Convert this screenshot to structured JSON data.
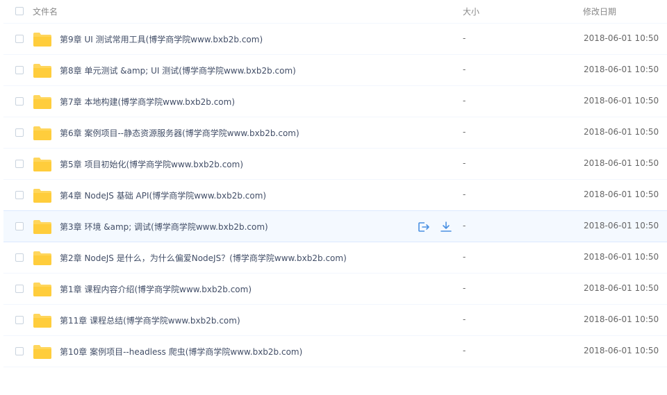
{
  "header": {
    "name_label": "文件名",
    "size_label": "大小",
    "date_label": "修改日期"
  },
  "files": [
    {
      "name": "第9章 UI 测试常用工具(博学商学院www.bxb2b.com)",
      "size": "-",
      "date": "2018-06-01 10:50"
    },
    {
      "name": "第8章 单元测试 &amp; UI 测试(博学商学院www.bxb2b.com)",
      "size": "-",
      "date": "2018-06-01 10:50"
    },
    {
      "name": "第7章 本地构建(博学商学院www.bxb2b.com)",
      "size": "-",
      "date": "2018-06-01 10:50"
    },
    {
      "name": "第6章 案例项目--静态资源服务器(博学商学院www.bxb2b.com)",
      "size": "-",
      "date": "2018-06-01 10:50"
    },
    {
      "name": "第5章 项目初始化(博学商学院www.bxb2b.com)",
      "size": "-",
      "date": "2018-06-01 10:50"
    },
    {
      "name": "第4章 NodeJS 基础 API(博学商学院www.bxb2b.com)",
      "size": "-",
      "date": "2018-06-01 10:50"
    },
    {
      "name": "第3章 环境 &amp; 调试(博学商学院www.bxb2b.com)",
      "size": "-",
      "date": "2018-06-01 10:50"
    },
    {
      "name": "第2章 NodeJS 是什么，为什么偏爱NodeJS？(博学商学院www.bxb2b.com)",
      "size": "-",
      "date": "2018-06-01 10:50"
    },
    {
      "name": "第1章 课程内容介绍(博学商学院www.bxb2b.com)",
      "size": "-",
      "date": "2018-06-01 10:50"
    },
    {
      "name": "第11章 课程总结(博学商学院www.bxb2b.com)",
      "size": "-",
      "date": "2018-06-01 10:50"
    },
    {
      "name": "第10章 案例项目--headless 爬虫(博学商学院www.bxb2b.com)",
      "size": "-",
      "date": "2018-06-01 10:50"
    }
  ],
  "icons": {
    "folder": "folder-icon",
    "share": "share-icon",
    "download": "download-icon"
  },
  "colors": {
    "folder": "#ffd65c",
    "accent": "#4a90e2",
    "hover_bg": "#f4f9ff"
  }
}
